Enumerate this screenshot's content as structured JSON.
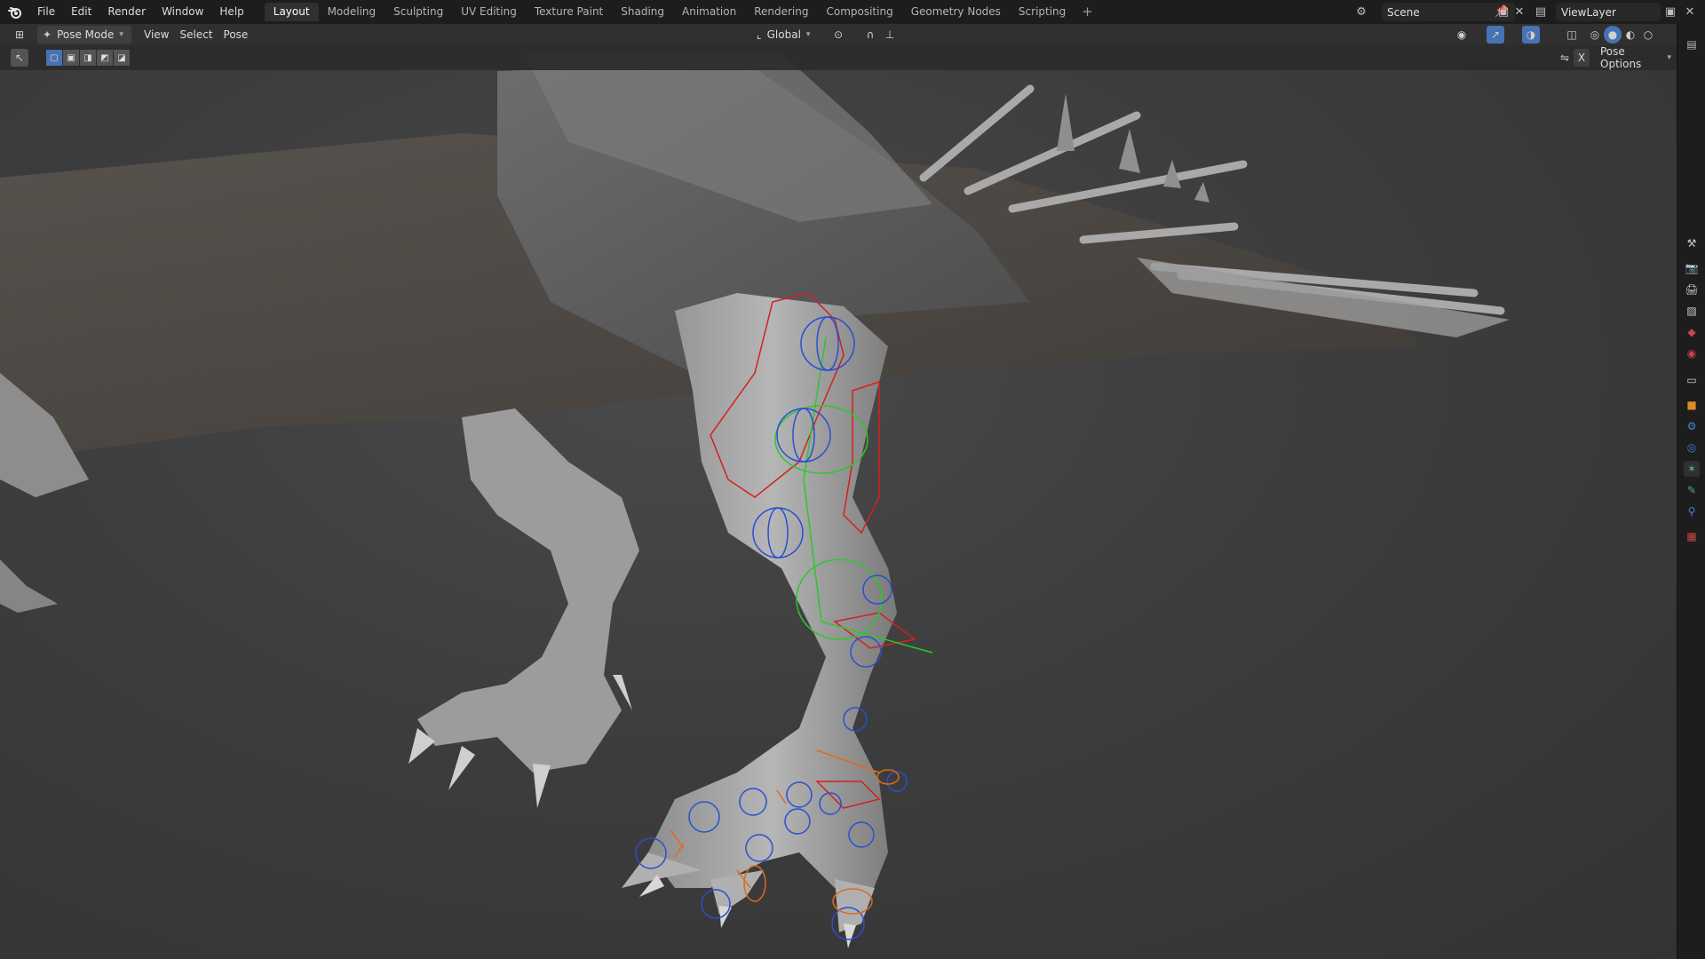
{
  "menu": [
    "File",
    "Edit",
    "Render",
    "Window",
    "Help"
  ],
  "workspaces": [
    {
      "label": "Layout",
      "active": true
    },
    {
      "label": "Modeling"
    },
    {
      "label": "Sculpting"
    },
    {
      "label": "UV Editing"
    },
    {
      "label": "Texture Paint"
    },
    {
      "label": "Shading"
    },
    {
      "label": "Animation"
    },
    {
      "label": "Rendering"
    },
    {
      "label": "Compositing"
    },
    {
      "label": "Geometry Nodes"
    },
    {
      "label": "Scripting"
    }
  ],
  "add_workspace": "+",
  "scene": {
    "label": "Scene"
  },
  "view_layer": {
    "label": "ViewLayer"
  },
  "header": {
    "mode": "Pose Mode",
    "view": "View",
    "select": "Select",
    "pose": "Pose",
    "orientation": "Global"
  },
  "toolheader": {
    "pose_options": "Pose Options",
    "x_mirror": "X"
  },
  "colors": {
    "accent": "#4772b3",
    "bone_blue": "#2a4fd0",
    "bone_green": "#2ec62e",
    "bone_red": "#d42020",
    "bone_orange": "#e06a1e"
  },
  "icons": {
    "logo": "blender-logo-icon",
    "editor_type": "3d-viewport-icon",
    "pose_mode": "pose-mode-icon",
    "transform_orientation": "orientation-icon",
    "pivot": "pivot-icon",
    "snap": "snap-magnet-icon",
    "proportional": "proportional-edit-icon",
    "visibility": "eye-icon",
    "gizmo": "gizmo-icon",
    "overlay": "overlay-icon",
    "xray": "xray-icon"
  }
}
